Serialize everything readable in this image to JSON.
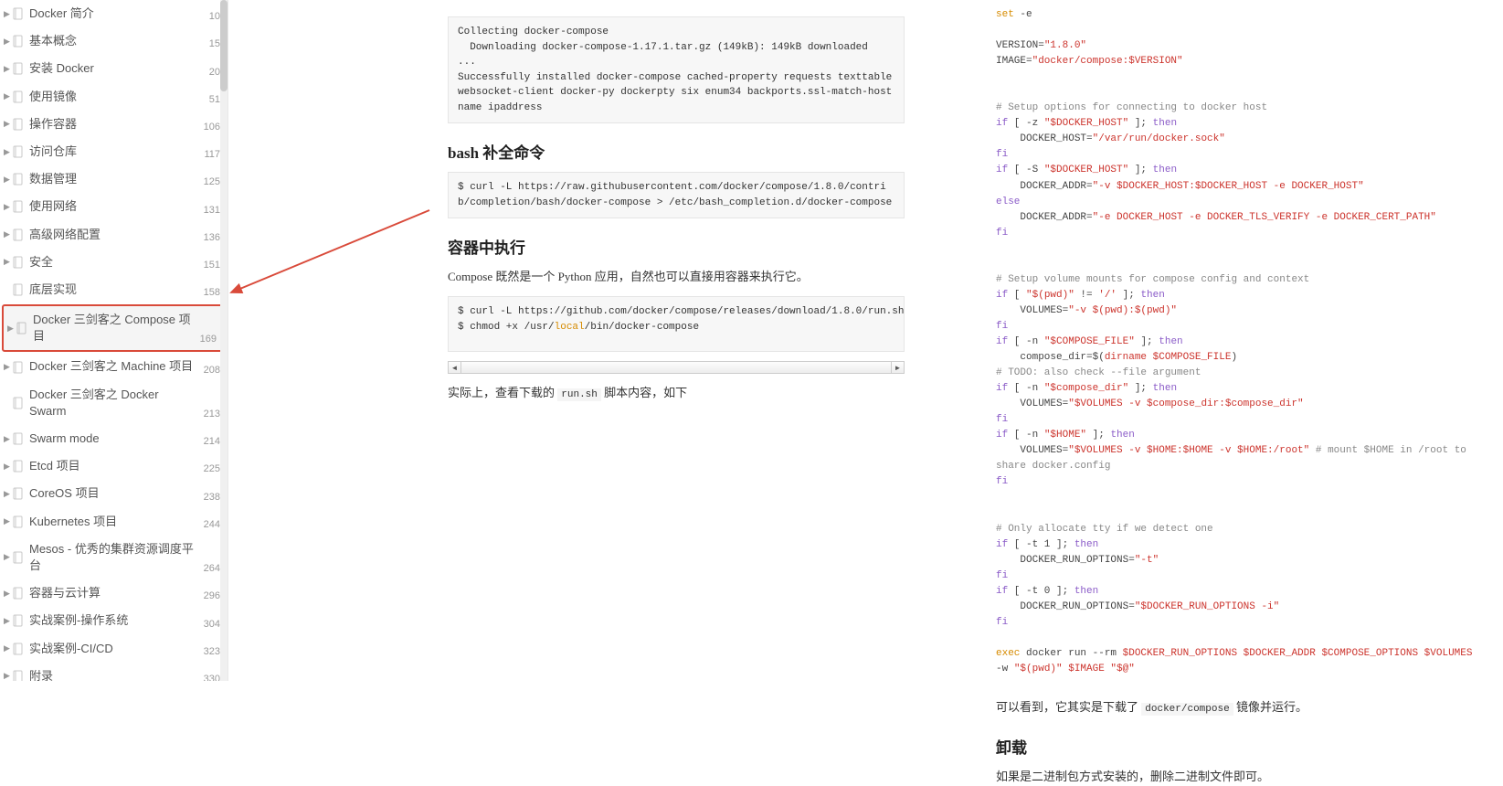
{
  "sidebar": {
    "items": [
      {
        "label": "Docker 简介",
        "page": "10",
        "hasChevron": true
      },
      {
        "label": "基本概念",
        "page": "15",
        "hasChevron": true
      },
      {
        "label": "安装 Docker",
        "page": "20",
        "hasChevron": true
      },
      {
        "label": "使用镜像",
        "page": "51",
        "hasChevron": true
      },
      {
        "label": "操作容器",
        "page": "106",
        "hasChevron": true
      },
      {
        "label": "访问仓库",
        "page": "117",
        "hasChevron": true
      },
      {
        "label": "数据管理",
        "page": "125",
        "hasChevron": true
      },
      {
        "label": "使用网络",
        "page": "131",
        "hasChevron": true
      },
      {
        "label": "高级网络配置",
        "page": "136",
        "hasChevron": true
      },
      {
        "label": "安全",
        "page": "151",
        "hasChevron": true
      },
      {
        "label": "底层实现",
        "page": "158",
        "hasChevron": false
      },
      {
        "label": "Docker 三剑客之 Compose 项目",
        "page": "169",
        "hasChevron": true,
        "active": true
      },
      {
        "label": "Docker 三剑客之 Machine 项目",
        "page": "208",
        "hasChevron": true
      },
      {
        "label": "Docker 三剑客之 Docker Swarm",
        "page": "213",
        "hasChevron": false
      },
      {
        "label": "Swarm mode",
        "page": "214",
        "hasChevron": true
      },
      {
        "label": "Etcd 项目",
        "page": "225",
        "hasChevron": true
      },
      {
        "label": "CoreOS 项目",
        "page": "238",
        "hasChevron": true
      },
      {
        "label": "Kubernetes 项目",
        "page": "244",
        "hasChevron": true
      },
      {
        "label": "Mesos - 优秀的集群资源调度平台",
        "page": "264",
        "hasChevron": true
      },
      {
        "label": "容器与云计算",
        "page": "296",
        "hasChevron": true
      },
      {
        "label": "实战案例-操作系统",
        "page": "304",
        "hasChevron": true
      },
      {
        "label": "实战案例-CI/CD",
        "page": "323",
        "hasChevron": true
      },
      {
        "label": "附录",
        "page": "330",
        "hasChevron": true
      }
    ]
  },
  "left": {
    "code1": "Collecting docker-compose\n  Downloading docker-compose-1.17.1.tar.gz (149kB): 149kB downloaded\n...\nSuccessfully installed docker-compose cached-property requests texttable websocket-client docker-py dockerpty six enum34 backports.ssl-match-hostname ipaddress",
    "heading_bash": "bash 补全命令",
    "code2": "$ curl -L https://raw.githubusercontent.com/docker/compose/1.8.0/contrib/completion/bash/docker-compose > /etc/bash_completion.d/docker-compose",
    "heading_container": "容器中执行",
    "para_container": "Compose 既然是一个 Python 应用，自然也可以直接用容器来执行它。",
    "code3_prefix": "$ curl -L https://github.com/docker/compose/releases/download/1.8.0/run.sh > /usr/",
    "code3_local1": "local",
    "code3_mid": "/bin/docker-compose\n$ chmod +x /usr/",
    "code3_local2": "local",
    "code3_suffix": "/bin/docker-compose",
    "para_script_intro_a": "实际上，查看下载的 ",
    "para_script_intro_mono": "run.sh",
    "para_script_intro_b": " 脚本内容，如下"
  },
  "right": {
    "script": {
      "l1a": "set",
      "l1b": " -e",
      "l2a": "VERSION=",
      "l2b": "\"1.8.0\"",
      "l3a": "IMAGE=",
      "l3b": "\"docker/compose:$VERSION\"",
      "c1": "# Setup options for connecting to docker host",
      "l4a": "if",
      "l4b": " [ -z ",
      "l4c": "\"$DOCKER_HOST\"",
      "l4d": " ]; ",
      "l4e": "then",
      "l5a": "    DOCKER_HOST=",
      "l5b": "\"/var/run/docker.sock\"",
      "fi": "fi",
      "l6a": "if",
      "l6b": " [ -S ",
      "l6c": "\"$DOCKER_HOST\"",
      "l6d": " ]; ",
      "l6e": "then",
      "l7a": "    DOCKER_ADDR=",
      "l7b": "\"-v $DOCKER_HOST:$DOCKER_HOST -e DOCKER_HOST\"",
      "else": "else",
      "l8a": "    DOCKER_ADDR=",
      "l8b": "\"-e DOCKER_HOST -e DOCKER_TLS_VERIFY -e DOCKER_CERT_PATH\"",
      "c2": "# Setup volume mounts for compose config and context",
      "l9a": "if",
      "l9b": " [ ",
      "l9c": "\"$(pwd)\"",
      "l9d": " != ",
      "l9e": "'/'",
      "l9f": " ]; ",
      "l9g": "then",
      "l10a": "    VOLUMES=",
      "l10b": "\"-v $(pwd):$(pwd)\"",
      "l11a": "if",
      "l11b": " [ -n ",
      "l11c": "\"$COMPOSE_FILE\"",
      "l11d": " ]; ",
      "l11e": "then",
      "l12a": "    compose_dir=$(",
      "l12b": "dirname $COMPOSE_FILE",
      "l12c": ")",
      "c3": "# TODO: also check --file argument",
      "l13a": "if",
      "l13b": " [ -n ",
      "l13c": "\"$compose_dir\"",
      "l13d": " ]; ",
      "l13e": "then",
      "l14a": "    VOLUMES=",
      "l14b": "\"$VOLUMES -v $compose_dir:$compose_dir\"",
      "l15a": "if",
      "l15b": " [ -n ",
      "l15c": "\"$HOME\"",
      "l15d": " ]; ",
      "l15e": "then",
      "l16a": "    VOLUMES=",
      "l16b": "\"$VOLUMES -v $HOME:$HOME -v $HOME:/root\"",
      "l16c": " # mount $HOME in /root to share docker.config",
      "c4": "# Only allocate tty if we detect one",
      "l17a": "if",
      "l17b": " [ -t 1 ]; ",
      "l17c": "then",
      "l18a": "    DOCKER_RUN_OPTIONS=",
      "l18b": "\"-t\"",
      "l19a": "if",
      "l19b": " [ -t 0 ]; ",
      "l19c": "then",
      "l20a": "    DOCKER_RUN_OPTIONS=",
      "l20b": "\"$DOCKER_RUN_OPTIONS -i\"",
      "l21a": "exec",
      "l21b": " docker run --rm ",
      "l21c": "$DOCKER_RUN_OPTIONS $DOCKER_ADDR $COMPOSE_OPTIONS $VOLUMES",
      "l21d": " -w ",
      "l21e": "\"$(pwd)\" $IMAGE \"$@\""
    },
    "para_download_a": "可以看到，它其实是下载了 ",
    "para_download_mono": "docker/compose",
    "para_download_b": " 镜像并运行。",
    "heading_uninstall": "卸载",
    "para_uninstall": "如果是二进制包方式安装的，删除二进制文件即可。"
  }
}
